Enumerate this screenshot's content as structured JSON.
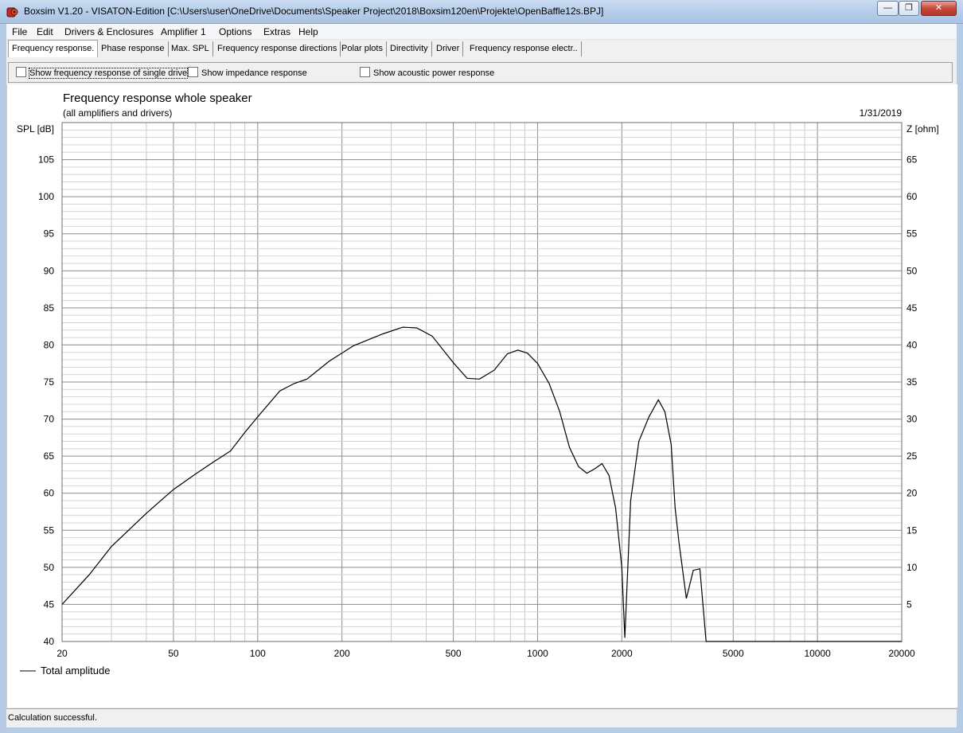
{
  "window": {
    "title": "Boxsim V1.20 - VISATON-Edition [C:\\Users\\user\\OneDrive\\Documents\\Speaker Project\\2018\\Boxsim120en\\Projekte\\OpenBaffle12s.BPJ]",
    "icon": "boxsim-app-icon",
    "minimize": "—",
    "maximize": "❐",
    "close": "✕"
  },
  "menu": [
    "File",
    "Edit",
    "Drivers & Enclosures",
    "Amplifier 1",
    "Options",
    "Extras",
    "Help"
  ],
  "tabs": [
    {
      "label": "Frequency response.",
      "active": true
    },
    {
      "label": "Phase response",
      "active": false
    },
    {
      "label": "Max. SPL",
      "active": false
    },
    {
      "label": "Frequency response directions",
      "active": false
    },
    {
      "label": "Polar plots",
      "active": false
    },
    {
      "label": "Directivity",
      "active": false
    },
    {
      "label": "Driver",
      "active": false
    },
    {
      "label": "Frequency response electr..",
      "active": false
    }
  ],
  "options": {
    "single_driver": {
      "label": "Show frequency response of single drive",
      "checked": false
    },
    "impedance": {
      "label": "Show impedance response",
      "checked": false
    },
    "acoustic_power": {
      "label": "Show acoustic power response",
      "checked": false
    }
  },
  "status": "Calculation successful.",
  "chart_data": {
    "type": "line",
    "title": "Frequency response whole speaker",
    "subtitle": "(all amplifiers and drivers)",
    "date": "1/31/2019",
    "ylabel": "SPL [dB]",
    "y2label": "Z [ohm]",
    "xscale": "log",
    "xlim": [
      20,
      20000
    ],
    "ylim": [
      40,
      110
    ],
    "y2lim": [
      0,
      70
    ],
    "xticks": [
      20,
      50,
      100,
      200,
      500,
      1000,
      2000,
      5000,
      10000,
      20000
    ],
    "yticks": [
      40,
      45,
      50,
      55,
      60,
      65,
      70,
      75,
      80,
      85,
      90,
      95,
      100,
      105
    ],
    "y2ticks": [
      5,
      10,
      15,
      20,
      25,
      30,
      35,
      40,
      45,
      50,
      55,
      60,
      65
    ],
    "grid": true,
    "legend_position": "bottom-left",
    "series": [
      {
        "name": "Total amplitude",
        "color": "#000000",
        "x": [
          20,
          25,
          30,
          40,
          50,
          60,
          70,
          80,
          90,
          100,
          120,
          135,
          150,
          180,
          220,
          280,
          330,
          370,
          420,
          500,
          560,
          620,
          700,
          780,
          850,
          920,
          1000,
          1100,
          1200,
          1300,
          1400,
          1500,
          1600,
          1700,
          1800,
          1900,
          2000,
          2050,
          2150,
          2300,
          2500,
          2700,
          2850,
          3000,
          3100,
          3200,
          3400,
          3600,
          3800,
          4000,
          20000
        ],
        "y": [
          45,
          49,
          52.8,
          57.3,
          60.5,
          62.6,
          64.3,
          65.7,
          68.2,
          70.3,
          73.8,
          74.8,
          75.4,
          77.8,
          79.9,
          81.5,
          82.4,
          82.3,
          81.2,
          77.6,
          75.5,
          75.4,
          76.6,
          78.8,
          79.3,
          78.9,
          77.5,
          74.8,
          71.0,
          66.2,
          63.6,
          62.7,
          63.3,
          64.0,
          62.4,
          58.0,
          50.0,
          40.5,
          59.0,
          67.0,
          70.3,
          72.6,
          71.0,
          66.6,
          58.0,
          53.4,
          45.8,
          49.6,
          49.8,
          40,
          40
        ]
      }
    ]
  }
}
